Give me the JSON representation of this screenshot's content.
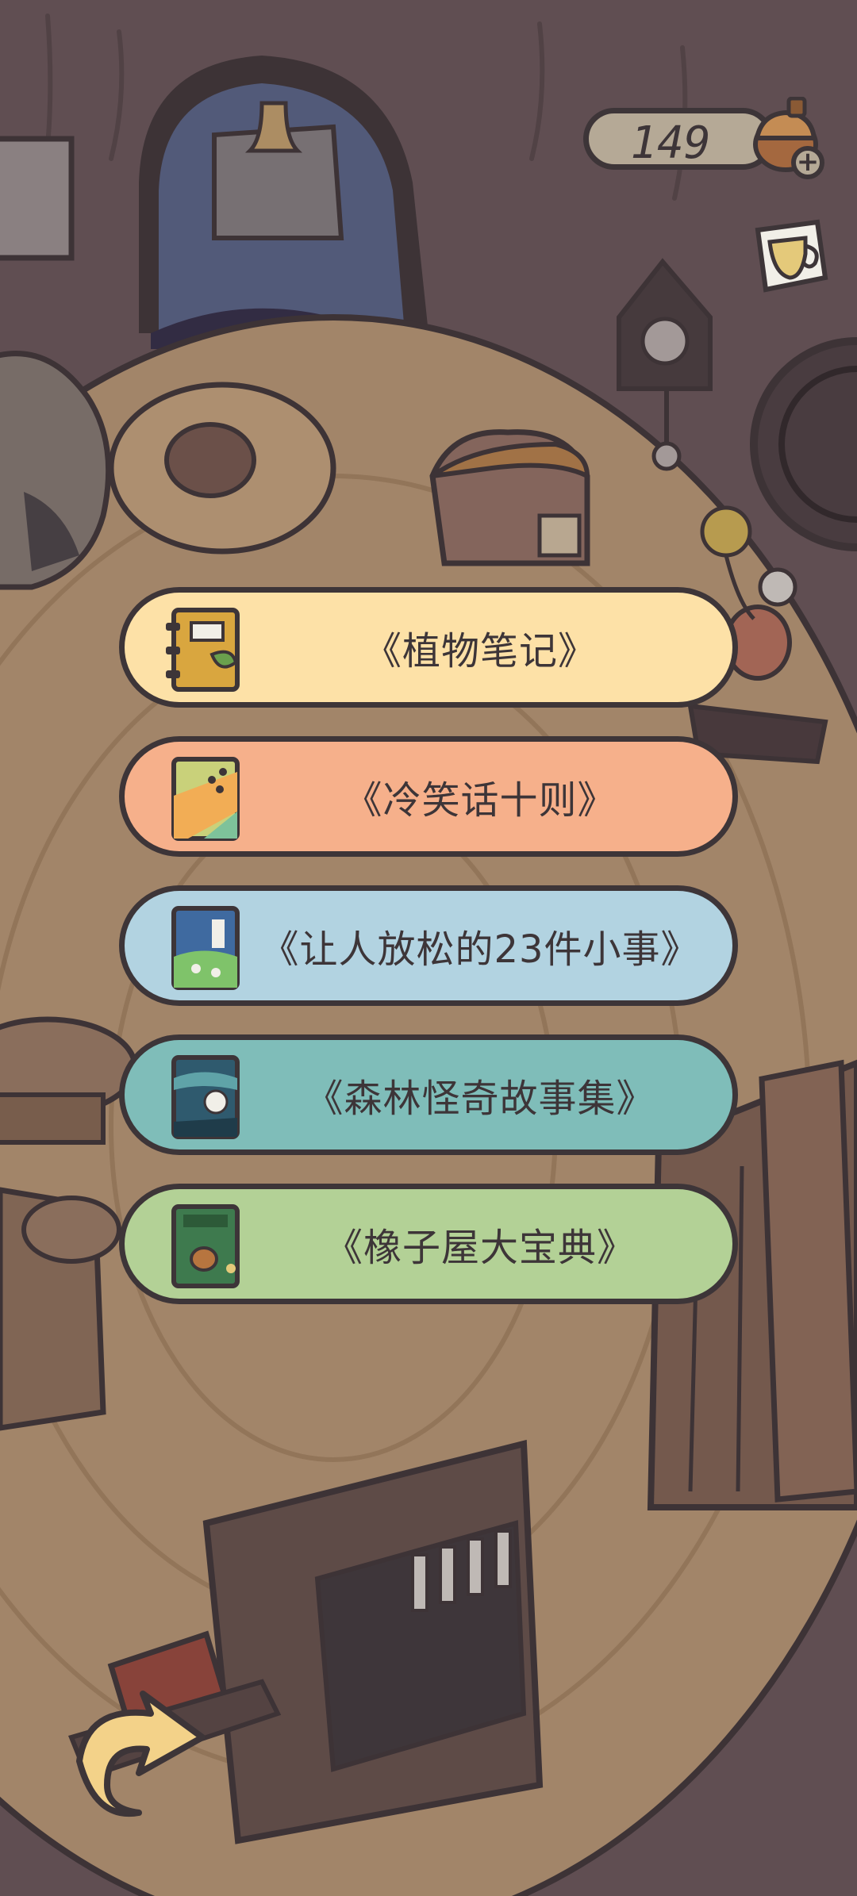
{
  "currency": {
    "count": "149",
    "icon": "acorn-icon",
    "add_icon": "plus-icon"
  },
  "menu": {
    "books": [
      {
        "label": "《植物笔记》",
        "color": "#fde1a7",
        "icon": "plant-notebook-icon"
      },
      {
        "label": "《冷笑话十则》",
        "color": "#f6b08b",
        "icon": "joke-book-icon"
      },
      {
        "label": "《让人放松的23件小事》",
        "color": "#b2d3e1",
        "icon": "relax-book-icon"
      },
      {
        "label": "《森林怪奇故事集》",
        "color": "#7fbdb9",
        "icon": "forest-story-book-icon"
      },
      {
        "label": "《橡子屋大宝典》",
        "color": "#b3d196",
        "icon": "acorn-house-book-icon"
      }
    ]
  },
  "colors": {
    "outline": "#3d3538",
    "floor": "#c9a77f",
    "wall": "#6d5a5e"
  }
}
